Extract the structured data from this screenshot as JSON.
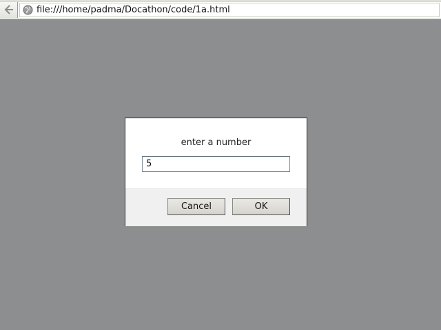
{
  "browser": {
    "url": "file:///home/padma/Docathon/code/1a.html",
    "icons": {
      "back": "back-arrow-icon",
      "site": "globe-icon"
    }
  },
  "dialog": {
    "message": "enter a number",
    "input_value": "5",
    "cancel_label": "Cancel",
    "ok_label": "OK"
  },
  "colors": {
    "overlay": "#8d8e8f",
    "dialog_bg": "#ffffff",
    "footer_bg": "#f0f0f0",
    "button_bg": "#dedcd6"
  }
}
